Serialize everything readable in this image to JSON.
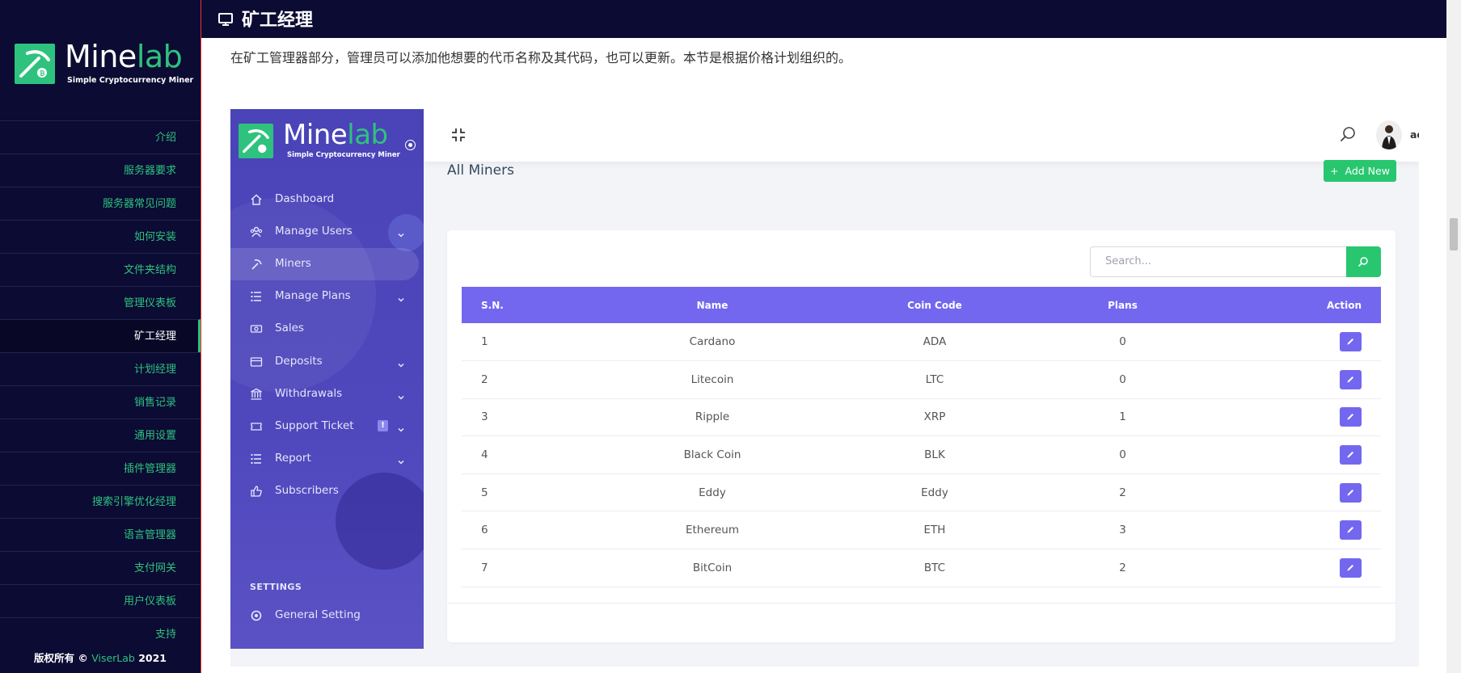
{
  "doc": {
    "logo": {
      "name_part1": "Mine",
      "name_part2": "lab",
      "tagline": "Simple Cryptocurrency Miner"
    },
    "nav": [
      {
        "label": "介绍",
        "active": false
      },
      {
        "label": "服务器要求",
        "active": false
      },
      {
        "label": "服务器常见问题",
        "active": false
      },
      {
        "label": "如何安装",
        "active": false
      },
      {
        "label": "文件夹结构",
        "active": false
      },
      {
        "label": "管理仪表板",
        "active": false
      },
      {
        "label": "矿工经理",
        "active": true
      },
      {
        "label": "计划经理",
        "active": false
      },
      {
        "label": "销售记录",
        "active": false
      },
      {
        "label": "通用设置",
        "active": false
      },
      {
        "label": "插件管理器",
        "active": false
      },
      {
        "label": "搜索引擎优化经理",
        "active": false
      },
      {
        "label": "语言管理器",
        "active": false
      },
      {
        "label": "支付网关",
        "active": false
      },
      {
        "label": "用户仪表板",
        "active": false
      },
      {
        "label": "支持",
        "active": false
      }
    ],
    "footer": {
      "prefix": "版权所有 ©",
      "brand": "ViserLab",
      "year": "2021"
    },
    "section_title": "矿工经理",
    "section_icon": "monitor-icon",
    "description": "在矿工管理器部分，管理员可以添加他想要的代币名称及其代码，也可以更新。本节是根据价格计划组织的。"
  },
  "app": {
    "logo": {
      "name_part1": "Mine",
      "name_part2": "lab",
      "tagline": "Simple Cryptocurrency Miner"
    },
    "nav": [
      {
        "label": "Dashboard",
        "icon": "home-icon",
        "active": false,
        "has_chevron": false
      },
      {
        "label": "Manage Users",
        "icon": "users-icon",
        "active": false,
        "has_chevron": true
      },
      {
        "label": "Miners",
        "icon": "pickaxe-icon",
        "active": true,
        "has_chevron": false
      },
      {
        "label": "Manage Plans",
        "icon": "list-icon",
        "active": false,
        "has_chevron": true
      },
      {
        "label": "Sales",
        "icon": "money-icon",
        "active": false,
        "has_chevron": false
      },
      {
        "label": "Deposits",
        "icon": "credit-card-icon",
        "active": false,
        "has_chevron": true
      },
      {
        "label": "Withdrawals",
        "icon": "bank-icon",
        "active": false,
        "has_chevron": true
      },
      {
        "label": "Support Ticket",
        "icon": "ticket-icon",
        "active": false,
        "has_chevron": true,
        "badge": "!"
      },
      {
        "label": "Report",
        "icon": "list-icon",
        "active": false,
        "has_chevron": true
      },
      {
        "label": "Subscribers",
        "icon": "thumbs-up-icon",
        "active": false,
        "has_chevron": false
      }
    ],
    "settings_heading": "SETTINGS",
    "settings_nav": [
      {
        "label": "General Setting",
        "icon": "settings-icon"
      }
    ],
    "topbar": {
      "user_name": "admin"
    },
    "page_title": "All Miners",
    "add_button": "Add New",
    "search_placeholder": "Search...",
    "table": {
      "headers": [
        "S.N.",
        "Name",
        "Coin Code",
        "Plans",
        "Action"
      ],
      "rows": [
        {
          "sn": "1",
          "name": "Cardano",
          "code": "ADA",
          "plans": "0"
        },
        {
          "sn": "2",
          "name": "Litecoin",
          "code": "LTC",
          "plans": "0"
        },
        {
          "sn": "3",
          "name": "Ripple",
          "code": "XRP",
          "plans": "1"
        },
        {
          "sn": "4",
          "name": "Black Coin",
          "code": "BLK",
          "plans": "0"
        },
        {
          "sn": "5",
          "name": "Eddy",
          "code": "Eddy",
          "plans": "2"
        },
        {
          "sn": "6",
          "name": "Ethereum",
          "code": "ETH",
          "plans": "3"
        },
        {
          "sn": "7",
          "name": "BitCoin",
          "code": "BTC",
          "plans": "2"
        }
      ]
    }
  },
  "colors": {
    "doc_bg": "#0b0b33",
    "accent_green": "#2ec27e",
    "app_sidebar": "#4f48bd",
    "table_header": "#7367f0",
    "button_green": "#28c76f"
  }
}
